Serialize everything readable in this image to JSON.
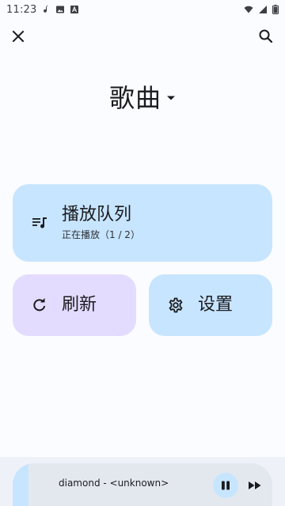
{
  "status_bar": {
    "time": "11:23",
    "left_icons": [
      "music-note-icon",
      "image-icon",
      "font-icon"
    ],
    "right_icons": [
      "wifi-icon",
      "signal-icon",
      "battery-icon"
    ]
  },
  "top_bar": {
    "close_icon": "close-icon",
    "search_icon": "search-icon"
  },
  "header": {
    "title": "歌曲"
  },
  "cards": {
    "queue": {
      "title": "播放队列",
      "subtitle": "正在播放（1 / 2）",
      "icon": "queue-music-icon"
    },
    "refresh": {
      "title": "刷新",
      "icon": "refresh-icon"
    },
    "settings": {
      "title": "设置",
      "icon": "gear-icon"
    }
  },
  "player": {
    "song": "diamond - <unknown>",
    "progress": 0.06
  },
  "colors": {
    "background": "#FBFCFF",
    "card_blue": "#C7E5FE",
    "card_purple": "#E4DCFE",
    "player_bg": "#E3E8EF"
  }
}
